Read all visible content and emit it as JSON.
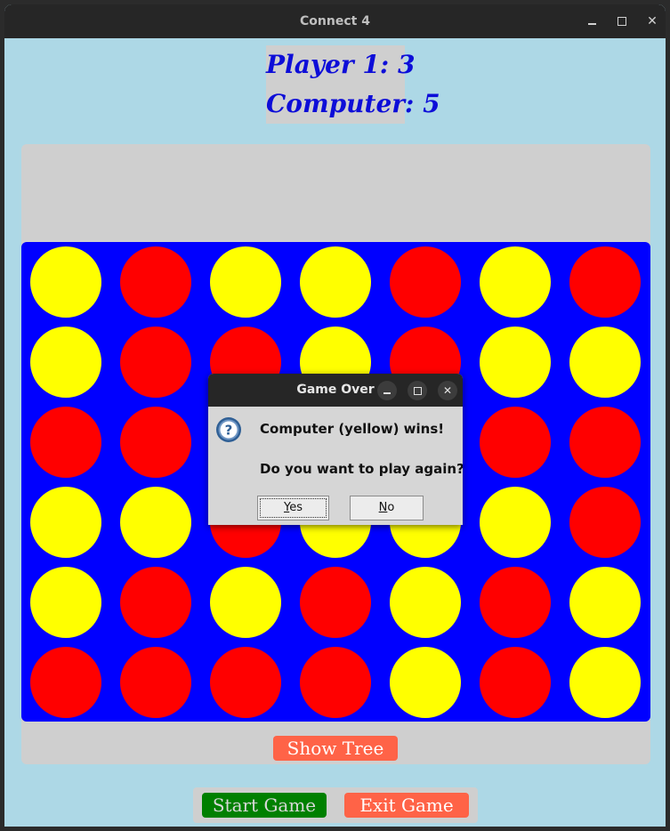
{
  "window": {
    "title": "Connect 4"
  },
  "scoreboard": {
    "player1": "Player 1: 3",
    "computer": "Computer: 5"
  },
  "board": {
    "rows": 6,
    "columns": 7,
    "colors": {
      "red": "#ff0000",
      "yellow": "#ffff00",
      "board": "#0000ff"
    },
    "cells": [
      [
        "yellow",
        "red",
        "yellow",
        "yellow",
        "red",
        "yellow",
        "red"
      ],
      [
        "yellow",
        "red",
        "red",
        "yellow",
        "red",
        "yellow",
        "yellow"
      ],
      [
        "red",
        "red",
        "yellow",
        "red",
        "yellow",
        "red",
        "red"
      ],
      [
        "yellow",
        "yellow",
        "red",
        "yellow",
        "yellow",
        "yellow",
        "red"
      ],
      [
        "yellow",
        "red",
        "yellow",
        "red",
        "yellow",
        "red",
        "yellow"
      ],
      [
        "red",
        "red",
        "red",
        "red",
        "yellow",
        "red",
        "yellow"
      ]
    ]
  },
  "buttons": {
    "show_tree": "Show Tree",
    "start_game": "Start Game",
    "exit_game": "Exit Game"
  },
  "dialog": {
    "title": "Game Over",
    "icon": "question-icon",
    "message_line1": "Computer (yellow) wins!",
    "message_line2": "Do you want to play again?",
    "yes_mnemonic": "Y",
    "yes_rest": "es",
    "no_mnemonic": "N",
    "no_rest": "o"
  }
}
